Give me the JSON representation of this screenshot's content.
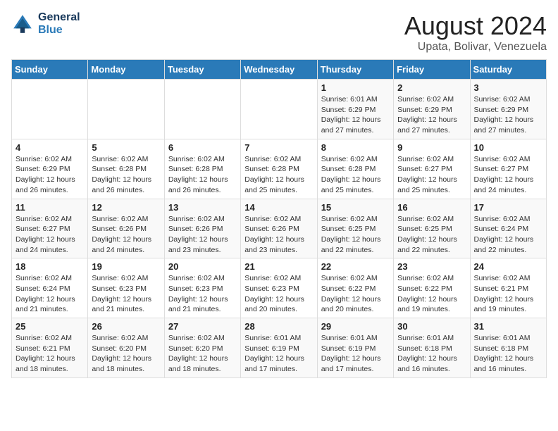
{
  "header": {
    "logo_line1": "General",
    "logo_line2": "Blue",
    "title": "August 2024",
    "subtitle": "Upata, Bolivar, Venezuela"
  },
  "days_of_week": [
    "Sunday",
    "Monday",
    "Tuesday",
    "Wednesday",
    "Thursday",
    "Friday",
    "Saturday"
  ],
  "weeks": [
    [
      {
        "num": "",
        "info": ""
      },
      {
        "num": "",
        "info": ""
      },
      {
        "num": "",
        "info": ""
      },
      {
        "num": "",
        "info": ""
      },
      {
        "num": "1",
        "info": "Sunrise: 6:01 AM\nSunset: 6:29 PM\nDaylight: 12 hours\nand 27 minutes."
      },
      {
        "num": "2",
        "info": "Sunrise: 6:02 AM\nSunset: 6:29 PM\nDaylight: 12 hours\nand 27 minutes."
      },
      {
        "num": "3",
        "info": "Sunrise: 6:02 AM\nSunset: 6:29 PM\nDaylight: 12 hours\nand 27 minutes."
      }
    ],
    [
      {
        "num": "4",
        "info": "Sunrise: 6:02 AM\nSunset: 6:29 PM\nDaylight: 12 hours\nand 26 minutes."
      },
      {
        "num": "5",
        "info": "Sunrise: 6:02 AM\nSunset: 6:28 PM\nDaylight: 12 hours\nand 26 minutes."
      },
      {
        "num": "6",
        "info": "Sunrise: 6:02 AM\nSunset: 6:28 PM\nDaylight: 12 hours\nand 26 minutes."
      },
      {
        "num": "7",
        "info": "Sunrise: 6:02 AM\nSunset: 6:28 PM\nDaylight: 12 hours\nand 25 minutes."
      },
      {
        "num": "8",
        "info": "Sunrise: 6:02 AM\nSunset: 6:28 PM\nDaylight: 12 hours\nand 25 minutes."
      },
      {
        "num": "9",
        "info": "Sunrise: 6:02 AM\nSunset: 6:27 PM\nDaylight: 12 hours\nand 25 minutes."
      },
      {
        "num": "10",
        "info": "Sunrise: 6:02 AM\nSunset: 6:27 PM\nDaylight: 12 hours\nand 24 minutes."
      }
    ],
    [
      {
        "num": "11",
        "info": "Sunrise: 6:02 AM\nSunset: 6:27 PM\nDaylight: 12 hours\nand 24 minutes."
      },
      {
        "num": "12",
        "info": "Sunrise: 6:02 AM\nSunset: 6:26 PM\nDaylight: 12 hours\nand 24 minutes."
      },
      {
        "num": "13",
        "info": "Sunrise: 6:02 AM\nSunset: 6:26 PM\nDaylight: 12 hours\nand 23 minutes."
      },
      {
        "num": "14",
        "info": "Sunrise: 6:02 AM\nSunset: 6:26 PM\nDaylight: 12 hours\nand 23 minutes."
      },
      {
        "num": "15",
        "info": "Sunrise: 6:02 AM\nSunset: 6:25 PM\nDaylight: 12 hours\nand 22 minutes."
      },
      {
        "num": "16",
        "info": "Sunrise: 6:02 AM\nSunset: 6:25 PM\nDaylight: 12 hours\nand 22 minutes."
      },
      {
        "num": "17",
        "info": "Sunrise: 6:02 AM\nSunset: 6:24 PM\nDaylight: 12 hours\nand 22 minutes."
      }
    ],
    [
      {
        "num": "18",
        "info": "Sunrise: 6:02 AM\nSunset: 6:24 PM\nDaylight: 12 hours\nand 21 minutes."
      },
      {
        "num": "19",
        "info": "Sunrise: 6:02 AM\nSunset: 6:23 PM\nDaylight: 12 hours\nand 21 minutes."
      },
      {
        "num": "20",
        "info": "Sunrise: 6:02 AM\nSunset: 6:23 PM\nDaylight: 12 hours\nand 21 minutes."
      },
      {
        "num": "21",
        "info": "Sunrise: 6:02 AM\nSunset: 6:23 PM\nDaylight: 12 hours\nand 20 minutes."
      },
      {
        "num": "22",
        "info": "Sunrise: 6:02 AM\nSunset: 6:22 PM\nDaylight: 12 hours\nand 20 minutes."
      },
      {
        "num": "23",
        "info": "Sunrise: 6:02 AM\nSunset: 6:22 PM\nDaylight: 12 hours\nand 19 minutes."
      },
      {
        "num": "24",
        "info": "Sunrise: 6:02 AM\nSunset: 6:21 PM\nDaylight: 12 hours\nand 19 minutes."
      }
    ],
    [
      {
        "num": "25",
        "info": "Sunrise: 6:02 AM\nSunset: 6:21 PM\nDaylight: 12 hours\nand 18 minutes."
      },
      {
        "num": "26",
        "info": "Sunrise: 6:02 AM\nSunset: 6:20 PM\nDaylight: 12 hours\nand 18 minutes."
      },
      {
        "num": "27",
        "info": "Sunrise: 6:02 AM\nSunset: 6:20 PM\nDaylight: 12 hours\nand 18 minutes."
      },
      {
        "num": "28",
        "info": "Sunrise: 6:01 AM\nSunset: 6:19 PM\nDaylight: 12 hours\nand 17 minutes."
      },
      {
        "num": "29",
        "info": "Sunrise: 6:01 AM\nSunset: 6:19 PM\nDaylight: 12 hours\nand 17 minutes."
      },
      {
        "num": "30",
        "info": "Sunrise: 6:01 AM\nSunset: 6:18 PM\nDaylight: 12 hours\nand 16 minutes."
      },
      {
        "num": "31",
        "info": "Sunrise: 6:01 AM\nSunset: 6:18 PM\nDaylight: 12 hours\nand 16 minutes."
      }
    ]
  ]
}
